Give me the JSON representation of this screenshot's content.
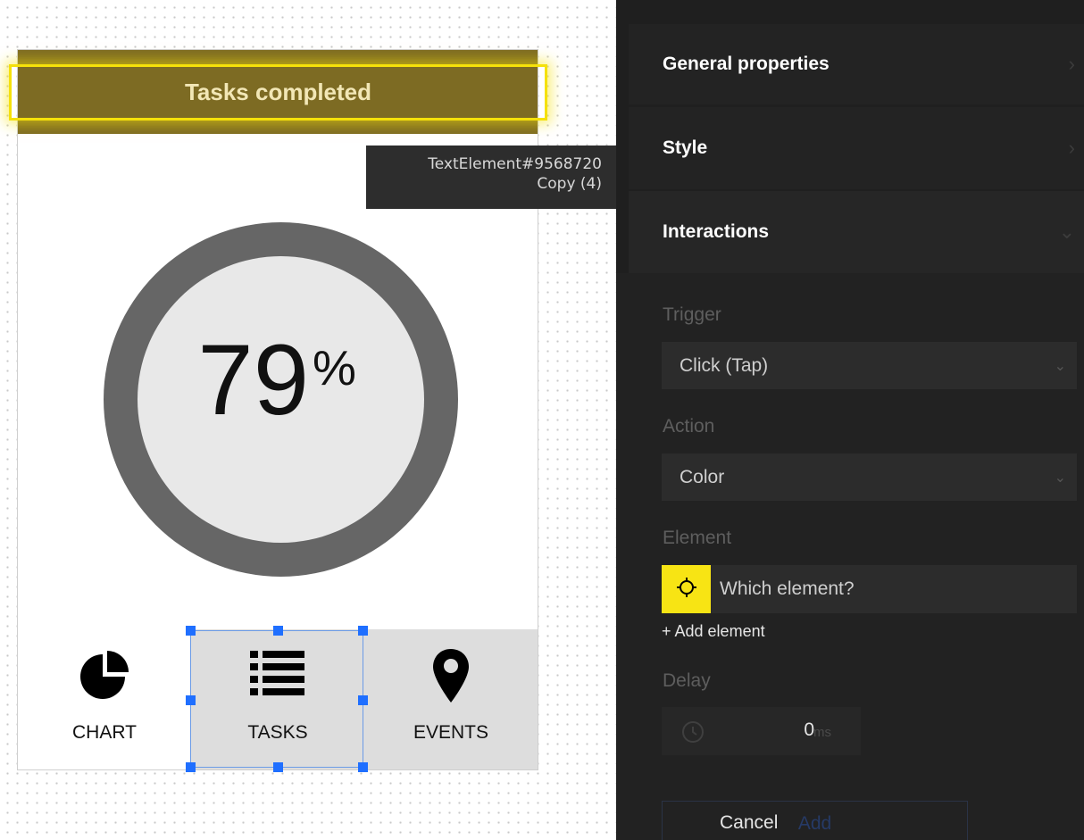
{
  "canvas": {
    "title": "Tasks completed",
    "tooltip_line1": "TextElement#9568720",
    "tooltip_line2": "Copy (4)",
    "percent_value": "79",
    "percent_sign": "%",
    "progress_fraction": 0.79,
    "tabs": [
      {
        "label": "CHART",
        "icon": "pie-chart-icon"
      },
      {
        "label": "TASKS",
        "icon": "list-icon"
      },
      {
        "label": "EVENTS",
        "icon": "map-pin-icon"
      }
    ],
    "colors": {
      "header": "#7d6b23",
      "selection": "#f5e10a",
      "ring": "#666666",
      "ring_inner": "#e8e8e8",
      "handle": "#1f6fff"
    }
  },
  "panel": {
    "sections": {
      "general": "General properties",
      "style": "Style",
      "interactions": "Interactions"
    },
    "trigger_label": "Trigger",
    "trigger_value": "Click (Tap)",
    "action_label": "Action",
    "action_value": "Color",
    "element_label": "Element",
    "element_placeholder": "Which element?",
    "add_element": "+ Add element",
    "delay_label": "Delay",
    "delay_value": "0",
    "delay_unit": "ms",
    "add_button": "Add",
    "cancel_button": "Cancel",
    "colors": {
      "background": "#1f1f1f",
      "target_button": "#f7e414"
    }
  }
}
